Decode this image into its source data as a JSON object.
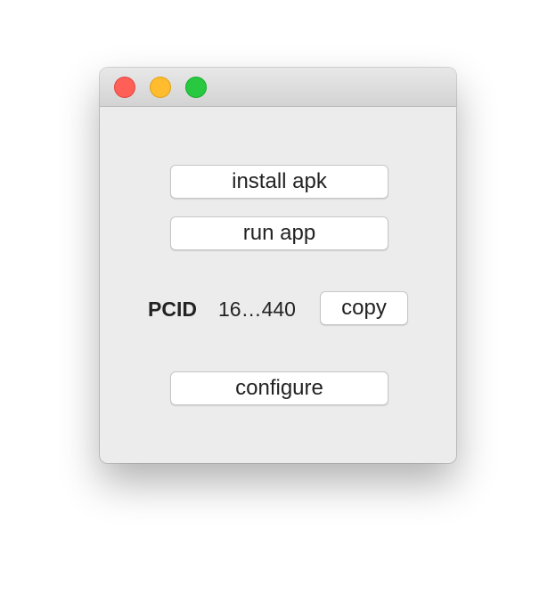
{
  "window": {
    "controls": {
      "close": "close-icon",
      "minimize": "minimize-icon",
      "zoom": "zoom-icon"
    },
    "colors": {
      "close": "#fe5f57",
      "minimize": "#febc2e",
      "zoom": "#28c840",
      "background": "#ececec"
    }
  },
  "actions": {
    "install_label": "install apk",
    "run_label": "run app",
    "configure_label": "configure"
  },
  "pcid": {
    "label": "PCID",
    "value": "16…440",
    "copy_label": "copy"
  }
}
